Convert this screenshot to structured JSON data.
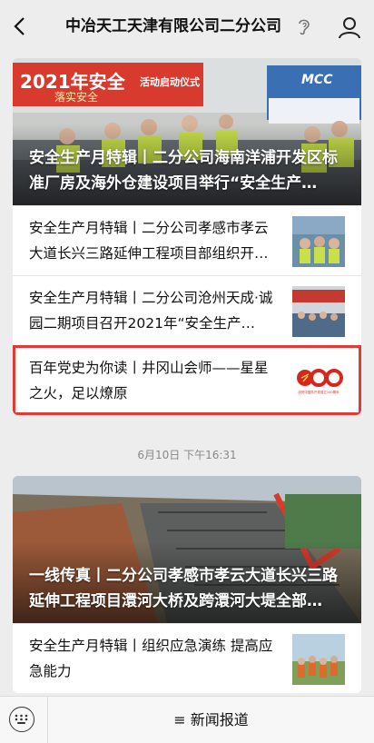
{
  "header": {
    "title": "中冶天工天津有限公司二分公司",
    "back_icon": "chevron-left-icon",
    "ear_icon": "ear-icon",
    "profile_icon": "person-icon"
  },
  "cards": [
    {
      "cover_caption": "安全生产月特辑丨二分公司海南洋浦开发区标准厂房及海外仓建设项目举行“安全生产…",
      "cover_banner": "2021年安全",
      "cover_banner_sub": "落实安全",
      "cover_banner_right": "活动启动仪式",
      "cover_logo": "MCC",
      "items": [
        {
          "text": "安全生产月特辑丨二分公司孝感市孝云大道长兴三路延伸工程项目部组织开…"
        },
        {
          "text": "安全生产月特辑丨二分公司沧州天成·诚园二期项目召开2021年“安全生产…"
        },
        {
          "text": "百年党史为你读丨井冈山会师——星星之火，足以燎原",
          "thumb_text": "100",
          "thumb_sub": "庆祝中国共产党成立100周年"
        }
      ]
    },
    {
      "cover_caption": "一线传真丨二分公司孝感市孝云大道长兴三路延伸工程项目澴河大桥及跨澴河大堤全部…",
      "items": [
        {
          "text": "安全生产月特辑丨组织应急演练 提高应急能力"
        }
      ]
    }
  ],
  "timestamp": "6月10日 下午16:31",
  "bottom": {
    "keyboard_icon": "keyboard-icon",
    "menu_icon": "menu-icon",
    "menu_label": "≡ 新闻报道"
  },
  "colors": {
    "highlight": "#e53935",
    "background": "#ededed"
  }
}
